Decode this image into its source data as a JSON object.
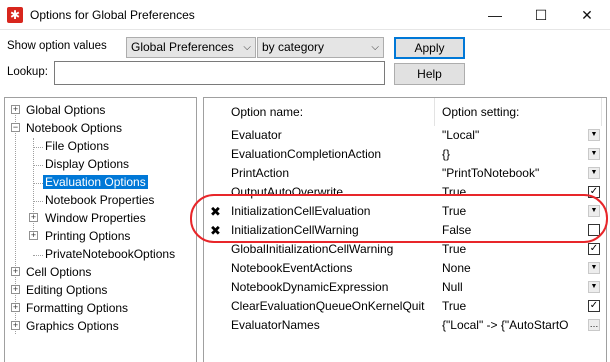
{
  "window": {
    "title": "Options for Global Preferences",
    "icon": "mathematica-star-icon",
    "minimize_glyph": "—",
    "maximize_glyph": "☐",
    "close_glyph": "✕"
  },
  "toolbar": {
    "show_label": "Show option values",
    "scope_value": "Global Preferences",
    "group_value": "by category",
    "apply_label": "Apply",
    "lookup_label": "Lookup:",
    "lookup_value": "",
    "help_label": "Help"
  },
  "tree": {
    "items": [
      {
        "label": "Global Options",
        "expander": "+"
      },
      {
        "label": "Notebook Options",
        "expander": "−"
      },
      {
        "label": "File Options"
      },
      {
        "label": "Display Options"
      },
      {
        "label": "Evaluation Options",
        "selected": true
      },
      {
        "label": "Notebook Properties"
      },
      {
        "label": "Window Properties",
        "expander": "+"
      },
      {
        "label": "Printing Options",
        "expander": "+"
      },
      {
        "label": "PrivateNotebookOptions"
      },
      {
        "label": "Cell Options",
        "expander": "+"
      },
      {
        "label": "Editing Options",
        "expander": "+"
      },
      {
        "label": "Formatting Options",
        "expander": "+"
      },
      {
        "label": "Graphics Options",
        "expander": "+"
      }
    ]
  },
  "grid": {
    "col_name_header": "Option name:",
    "col_value_header": "Option setting:",
    "rows": [
      {
        "name": "Evaluator",
        "value": "\"Local\"",
        "control": "drop",
        "marker": ""
      },
      {
        "name": "EvaluationCompletionAction",
        "value": "{}",
        "control": "drop",
        "marker": ""
      },
      {
        "name": "PrintAction",
        "value": "\"PrintToNotebook\"",
        "control": "drop",
        "marker": ""
      },
      {
        "name": "OutputAutoOverwrite",
        "value": "True",
        "control": "check",
        "checked": "✓",
        "marker": ""
      },
      {
        "name": "InitializationCellEvaluation",
        "value": "True",
        "control": "drop",
        "marker": "✖"
      },
      {
        "name": "InitializationCellWarning",
        "value": "False",
        "control": "check",
        "checked": "",
        "marker": "✖"
      },
      {
        "name": "GlobalInitializationCellWarning",
        "value": "True",
        "control": "check",
        "checked": "✓",
        "marker": ""
      },
      {
        "name": "NotebookEventActions",
        "value": "None",
        "control": "drop",
        "marker": ""
      },
      {
        "name": "NotebookDynamicExpression",
        "value": "Null",
        "control": "drop",
        "marker": ""
      },
      {
        "name": "ClearEvaluationQueueOnKernelQuit",
        "value": "True",
        "control": "check",
        "checked": "✓",
        "marker": ""
      },
      {
        "name": "EvaluatorNames",
        "value": "{\"Local\" -> {\"AutoStartO",
        "control": "more",
        "marker": ""
      }
    ]
  },
  "colors": {
    "selection": "#0078d7",
    "highlight_oval": "#e8262a"
  }
}
